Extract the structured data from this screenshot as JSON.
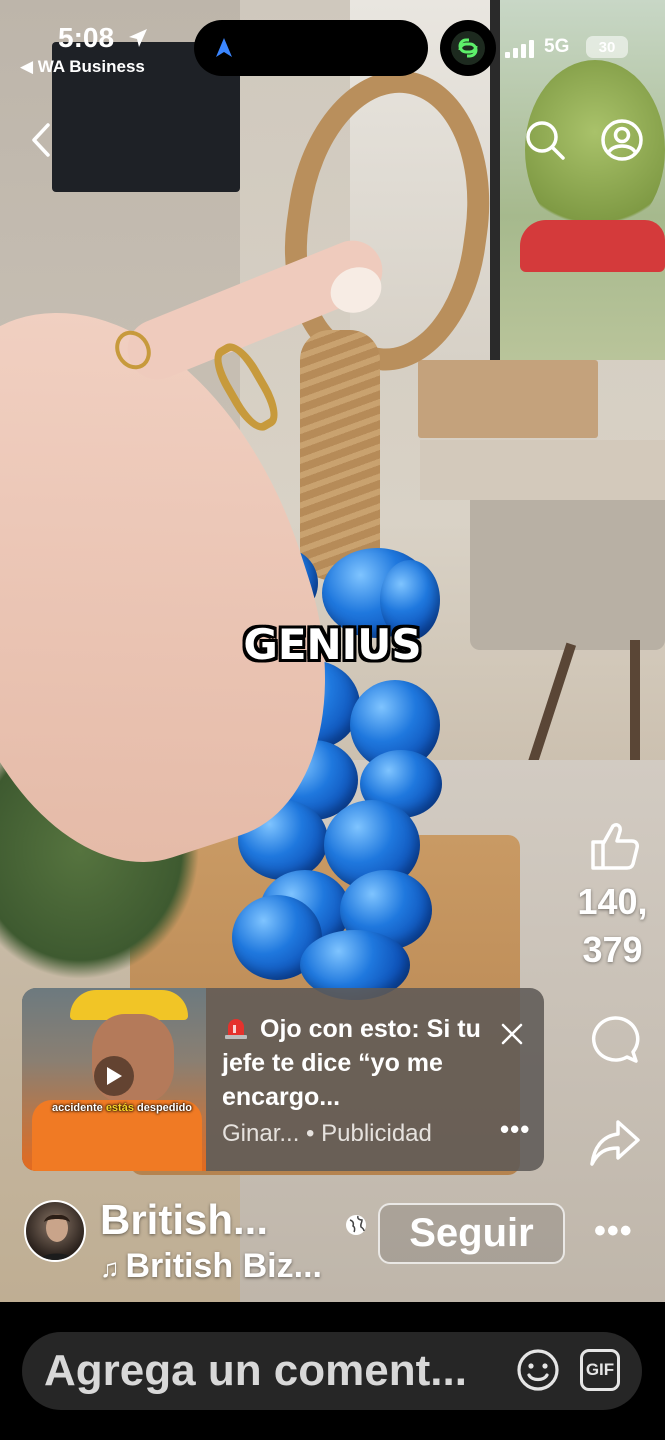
{
  "status_bar": {
    "time": "5:08",
    "back_app": "◀ WA Business",
    "network": "5G",
    "battery": "30"
  },
  "video": {
    "overlay_text": "GENIUS"
  },
  "actions": {
    "like_count": "140,\n379"
  },
  "ad": {
    "thumbnail_caption_prefix": "accidente ",
    "thumbnail_caption_highlight": "estás",
    "thumbnail_caption_suffix": " despedido",
    "text": "Ojo con esto: Si tu jefe te dice “yo me encargo...",
    "advertiser": "Ginar...",
    "sponsored_label": "• Publicidad"
  },
  "author": {
    "name": "British...",
    "follow_label": "Seguir",
    "audio": "British Biz..."
  },
  "comment_bar": {
    "placeholder": "Agrega un coment...",
    "gif_label": "GIF"
  },
  "icons": {
    "location_arrow": "location-arrow-icon",
    "navigation": "navigation-icon",
    "threads": "threads-app-icon",
    "back": "chevron-left-icon",
    "search": "search-icon",
    "profile": "profile-icon",
    "like": "thumbs-up-icon",
    "comment": "comment-bubble-icon",
    "share": "share-arrow-icon",
    "close": "close-icon",
    "globe": "globe-icon",
    "emoji": "emoji-icon",
    "siren": "siren-icon"
  },
  "colors": {
    "ad_background": "#5f5a56",
    "comment_bar": "#262626",
    "grape_blue": "#1f78de"
  }
}
